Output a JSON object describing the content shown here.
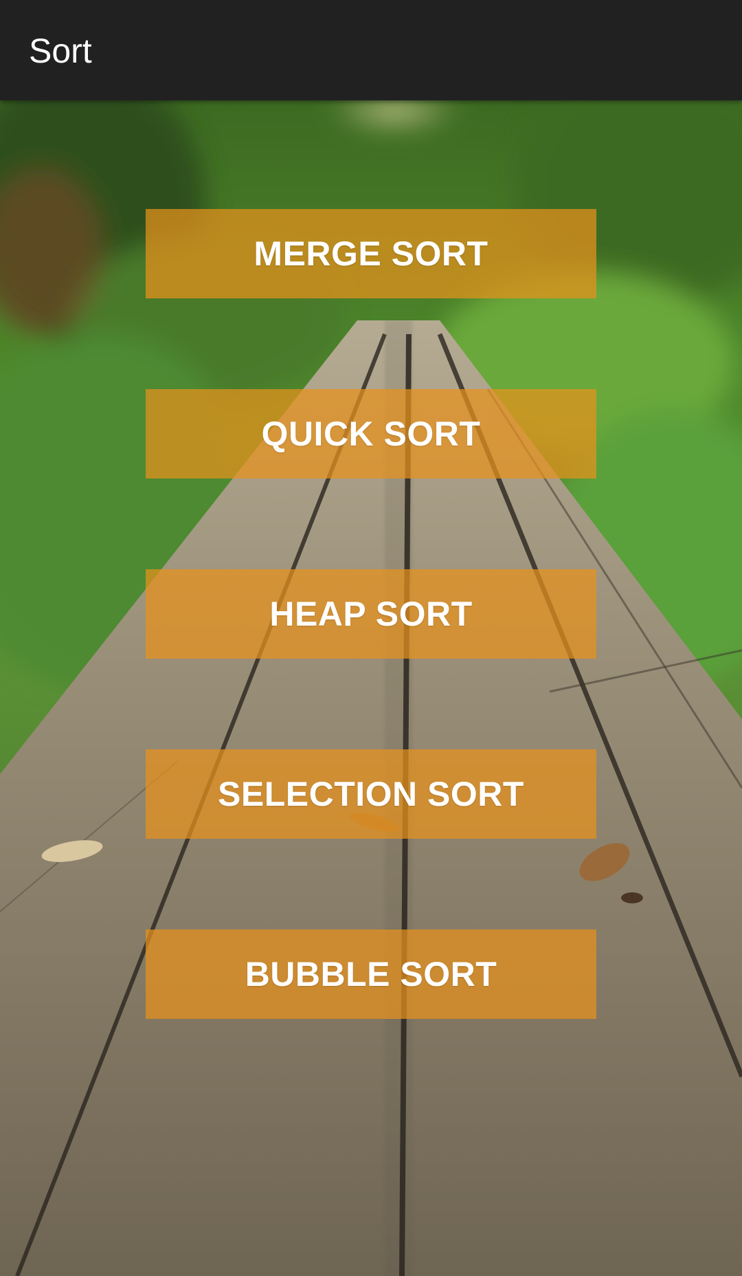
{
  "app_bar": {
    "title": "Sort"
  },
  "background": {
    "description_icon": "wooden-boardwalk-photo"
  },
  "buttons": [
    {
      "label": "MERGE SORT"
    },
    {
      "label": "QUICK SORT"
    },
    {
      "label": "HEAP SORT"
    },
    {
      "label": "SELECTION SORT"
    },
    {
      "label": "BUBBLE SORT"
    }
  ],
  "colors": {
    "app_bar": "#212121",
    "button": "#E8921C",
    "button_text": "#FFFFFF"
  }
}
